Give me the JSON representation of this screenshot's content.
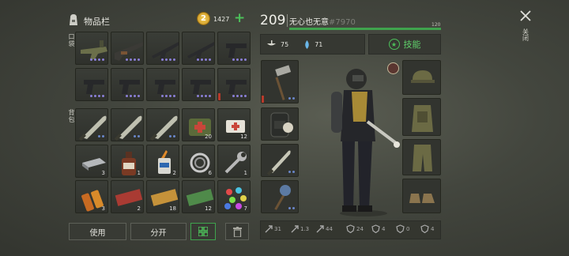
{
  "inventory": {
    "title": "物品栏",
    "coins": "1427",
    "add_icon": "plus-icon",
    "pockets_label": "口袋",
    "backpack_label": "背包",
    "pocket_items": [
      {
        "icon": "machine-gun-icon",
        "count": ""
      },
      {
        "icon": "shotgun-icon",
        "count": ""
      },
      {
        "icon": "assault-rifle-icon",
        "count": ""
      },
      {
        "icon": "assault-rifle-icon",
        "count": ""
      },
      {
        "icon": "pistol-icon",
        "count": ""
      },
      {
        "icon": "pistol-icon",
        "count": ""
      },
      {
        "icon": "pistol-icon",
        "count": ""
      },
      {
        "icon": "pistol-icon",
        "count": ""
      },
      {
        "icon": "pistol-icon",
        "count": ""
      },
      {
        "icon": "pistol-icon",
        "count": ""
      }
    ],
    "backpack_items": [
      {
        "icon": "machete-icon",
        "count": ""
      },
      {
        "icon": "machete-icon",
        "count": ""
      },
      {
        "icon": "machete-icon",
        "count": ""
      },
      {
        "icon": "medkit-icon",
        "count": "20"
      },
      {
        "icon": "bandage-icon",
        "count": "12"
      },
      {
        "icon": "metal-bar-icon",
        "count": "3"
      },
      {
        "icon": "bottle-icon",
        "count": "1"
      },
      {
        "icon": "glue-icon",
        "count": "2"
      },
      {
        "icon": "bearing-icon",
        "count": "6"
      },
      {
        "icon": "wrench-icon",
        "count": "1"
      },
      {
        "icon": "battery-icon",
        "count": "3"
      },
      {
        "icon": "ticket-red-icon",
        "count": "2"
      },
      {
        "icon": "ticket-gold-icon",
        "count": "18"
      },
      {
        "icon": "ticket-green-icon",
        "count": "12"
      },
      {
        "icon": "gems-icon",
        "count": "7"
      }
    ],
    "use_label": "使用",
    "split_label": "分开",
    "grid_icon": "grid-icon",
    "trash_icon": "trash-icon"
  },
  "player": {
    "level": "209",
    "name": "无心也无意",
    "id": "#7970",
    "xp_max": "120",
    "xp_fraction": 1.0,
    "food": "75",
    "water": "71",
    "skills_label": "技能",
    "close_label": "关闭"
  },
  "stats": [
    {
      "icon": "sword-icon",
      "value": "31"
    },
    {
      "icon": "sword-speed-icon",
      "value": "1.3"
    },
    {
      "icon": "run-icon",
      "value": "44"
    },
    {
      "icon": "shield-icon",
      "value": "24"
    },
    {
      "icon": "shield-bio-icon",
      "value": "4"
    },
    {
      "icon": "shield-rad-icon",
      "value": "0"
    },
    {
      "icon": "shield-cold-icon",
      "value": "4"
    }
  ],
  "colors": {
    "accent_green": "#3fa34d",
    "coin_gold": "#e0b23a",
    "durability_red": "#b83a2b"
  }
}
